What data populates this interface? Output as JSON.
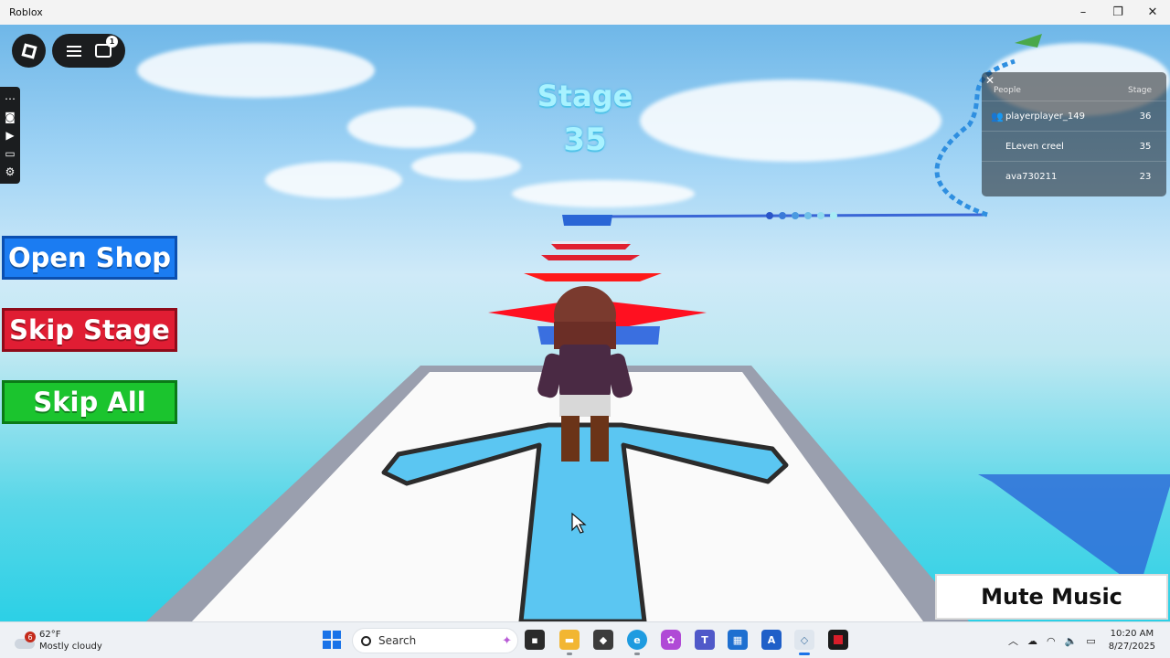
{
  "window": {
    "title": "Roblox",
    "minimize_glyph": "–",
    "maximize_glyph": "❐",
    "close_glyph": "✕"
  },
  "hud": {
    "chat_badge": "1",
    "stage_label": "Stage",
    "stage_number": "35"
  },
  "buttons": {
    "open_shop": "Open Shop",
    "skip_stage": "Skip Stage",
    "skip_all": "Skip All",
    "mute_music": "Mute Music"
  },
  "leaderboard": {
    "close_glyph": "✕",
    "col_people": "People",
    "col_stage": "Stage",
    "rows": [
      {
        "name": "playerplayer_149",
        "stage": "36",
        "has_icon": true
      },
      {
        "name": "ELeven creel",
        "stage": "35",
        "has_icon": false
      },
      {
        "name": "ava730211",
        "stage": "23",
        "has_icon": false
      }
    ]
  },
  "taskbar": {
    "weather_badge": "6",
    "temperature": "62°F",
    "condition": "Mostly cloudy",
    "search_placeholder": "Search",
    "time": "10:20 AM",
    "date": "8/27/2025"
  },
  "colors": {
    "open_shop": "#1b7cf2",
    "skip_stage": "#e01d33",
    "skip_all": "#1bc42e",
    "stage_text": "#a8f2ff"
  }
}
